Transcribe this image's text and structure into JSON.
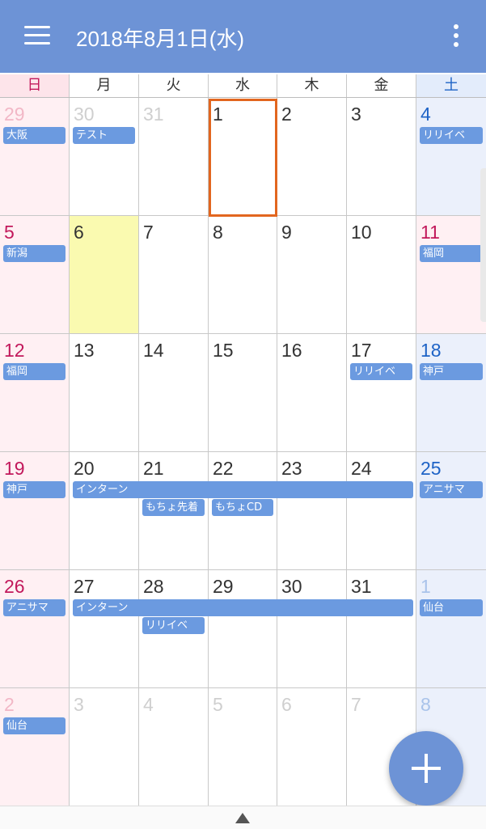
{
  "header": {
    "title": "2018年8月1日(水)"
  },
  "weekdays": [
    "日",
    "月",
    "火",
    "水",
    "木",
    "金",
    "土"
  ],
  "colors": {
    "accent": "#6d93d6",
    "sunday": "#c2185b",
    "saturday": "#1e63c6",
    "today_border": "#e2661f"
  },
  "weeks": [
    [
      {
        "day": "29",
        "out": true,
        "ev": "大阪"
      },
      {
        "day": "30",
        "out": true,
        "ev": "テスト"
      },
      {
        "day": "31",
        "out": true
      },
      {
        "day": "1",
        "today": true
      },
      {
        "day": "2"
      },
      {
        "day": "3"
      },
      {
        "day": "4",
        "ev": "リリイベ"
      }
    ],
    [
      {
        "day": "5",
        "ev": "新潟"
      },
      {
        "day": "6",
        "highlight": true
      },
      {
        "day": "7"
      },
      {
        "day": "8"
      },
      {
        "day": "9"
      },
      {
        "day": "10"
      },
      {
        "day": "11",
        "ev": "福岡"
      }
    ],
    [
      {
        "day": "12",
        "ev": "福岡"
      },
      {
        "day": "13"
      },
      {
        "day": "14"
      },
      {
        "day": "15"
      },
      {
        "day": "16"
      },
      {
        "day": "17",
        "ev": "リリイベ"
      },
      {
        "day": "18",
        "ev": "神戸"
      }
    ],
    [
      {
        "day": "19",
        "ev": "神戸"
      },
      {
        "day": "20"
      },
      {
        "day": "21",
        "ev2": "もちょ先着"
      },
      {
        "day": "22",
        "ev2": "もちょCD"
      },
      {
        "day": "23"
      },
      {
        "day": "24"
      },
      {
        "day": "25",
        "ev": "アニサマ"
      }
    ],
    [
      {
        "day": "26",
        "ev": "アニサマ"
      },
      {
        "day": "27"
      },
      {
        "day": "28",
        "ev2": "リリイベ"
      },
      {
        "day": "29"
      },
      {
        "day": "30"
      },
      {
        "day": "31"
      },
      {
        "day": "1",
        "out": true,
        "ev": "仙台"
      }
    ],
    [
      {
        "day": "2",
        "out": true,
        "ev": "仙台"
      },
      {
        "day": "3",
        "out": true
      },
      {
        "day": "4",
        "out": true
      },
      {
        "day": "5",
        "out": true
      },
      {
        "day": "6",
        "out": true
      },
      {
        "day": "7",
        "out": true
      },
      {
        "day": "8",
        "out": true
      }
    ]
  ],
  "spans": [
    {
      "week": 3,
      "label": "インターン"
    },
    {
      "week": 4,
      "label": "インターン"
    }
  ]
}
